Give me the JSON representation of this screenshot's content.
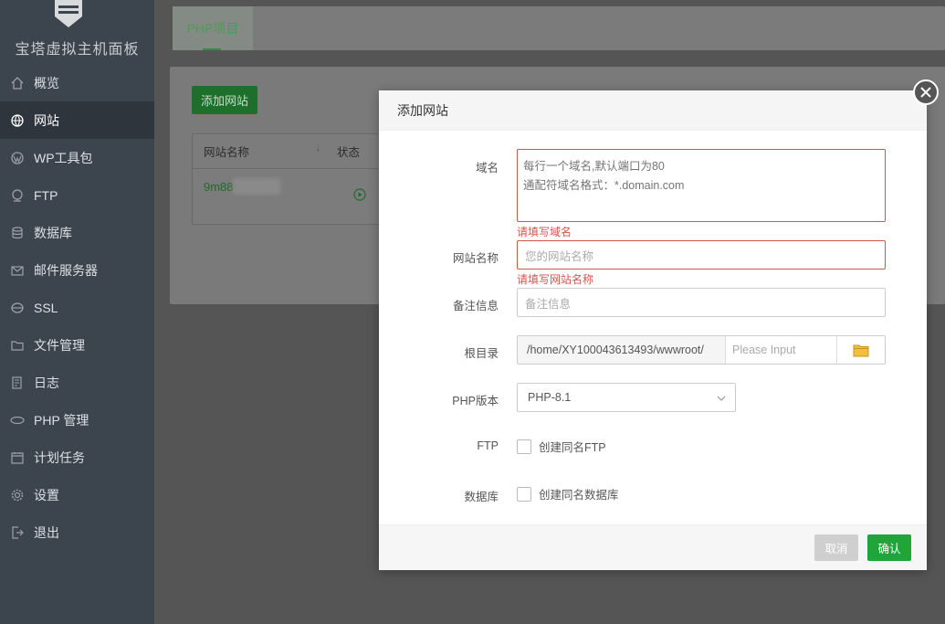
{
  "sidebar": {
    "brand": "宝塔虚拟主机面板",
    "items": [
      {
        "label": "概览",
        "icon": "home-icon"
      },
      {
        "label": "网站",
        "icon": "globe-icon",
        "active": true
      },
      {
        "label": "WP工具包",
        "icon": "wordpress-icon"
      },
      {
        "label": "FTP",
        "icon": "ftp-icon"
      },
      {
        "label": "数据库",
        "icon": "database-icon"
      },
      {
        "label": "邮件服务器",
        "icon": "mail-icon"
      },
      {
        "label": "SSL",
        "icon": "ssl-icon"
      },
      {
        "label": "文件管理",
        "icon": "folder-icon"
      },
      {
        "label": "日志",
        "icon": "log-icon"
      },
      {
        "label": "PHP 管理",
        "icon": "php-icon"
      },
      {
        "label": "计划任务",
        "icon": "calendar-icon"
      },
      {
        "label": "设置",
        "icon": "gear-icon"
      },
      {
        "label": "退出",
        "icon": "logout-icon"
      }
    ]
  },
  "tabs": {
    "active_label": "PHP项目"
  },
  "content": {
    "add_button": "添加网站",
    "table": {
      "col_name": "网站名称",
      "col_status": "状态",
      "row_name": "9m88"
    }
  },
  "modal": {
    "title": "添加网站",
    "domain": {
      "label": "域名",
      "placeholder": "每行一个域名,默认端口为80\n通配符域名格式：*.domain.com",
      "error": "请填写域名"
    },
    "site_name": {
      "label": "网站名称",
      "placeholder": "您的网站名称",
      "error": "请填写网站名称"
    },
    "remark": {
      "label": "备注信息",
      "placeholder": "备注信息"
    },
    "root": {
      "label": "根目录",
      "prefix": "/home/XY100043613493/wwwroot/",
      "placeholder": "Please Input"
    },
    "php": {
      "label": "PHP版本",
      "value": "PHP-8.1"
    },
    "ftp": {
      "label": "FTP",
      "checkbox_label": "创建同名FTP"
    },
    "db": {
      "label": "数据库",
      "checkbox_label": "创建同名数据库"
    },
    "cancel": "取消",
    "confirm": "确认"
  },
  "colors": {
    "accent": "#20a53a",
    "error": "#d9534f",
    "sidebar": "#3c444d"
  }
}
